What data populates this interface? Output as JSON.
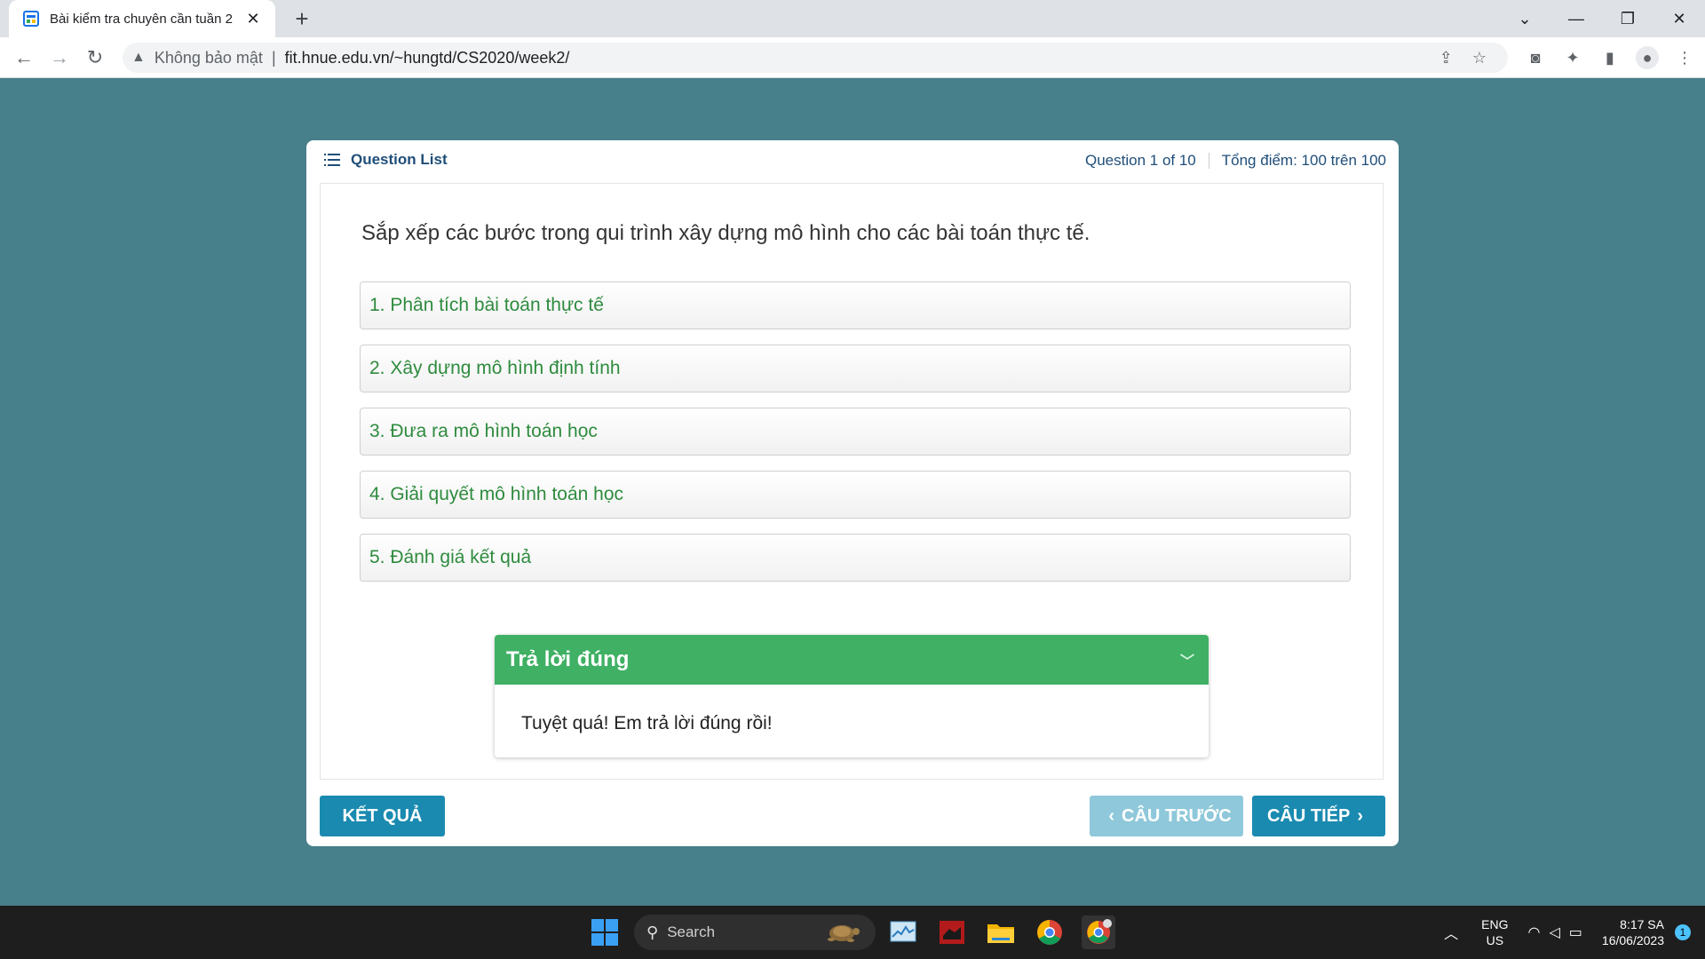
{
  "browser": {
    "tab_title": "Bài kiểm tra chuyên cần tuần 2",
    "tab_close": "✕",
    "new_tab": "+",
    "security_label": "Không bảo mật",
    "url": "fit.hnue.edu.vn/~hungtd/CS2020/week2/"
  },
  "quiz": {
    "question_list_label": "Question List",
    "question_counter": "Question 1 of 10",
    "score_label": "Tổng điểm: 100 trên 100",
    "question": "Sắp xếp các bước trong qui trình xây dựng mô hình cho các bài toán thực tế.",
    "options": [
      "1. Phân tích bài toán thực tế",
      "2. Xây dựng mô hình định tính",
      "3. Đưa ra mô hình toán học",
      "4. Giải quyết mô hình toán học",
      "5. Đánh giá kết quả"
    ],
    "feedback": {
      "title": "Trả lời đúng",
      "message": "Tuyệt quá! Em trả lời đúng rồi!"
    },
    "buttons": {
      "result": "KẾT QUẢ",
      "prev": "CÂU TRƯỚC",
      "next": "CÂU TIẾP"
    }
  },
  "taskbar": {
    "search_placeholder": "Search",
    "lang_line1": "ENG",
    "lang_line2": "US",
    "time": "8:17 SA",
    "date": "16/06/2023",
    "notification_count": "1"
  },
  "colors": {
    "page_background": "#477f8a",
    "option_text": "#2e8b3e",
    "feedback_header": "#3fb064",
    "primary_button": "#1a8ab0",
    "disabled_button": "#8ec8da"
  }
}
